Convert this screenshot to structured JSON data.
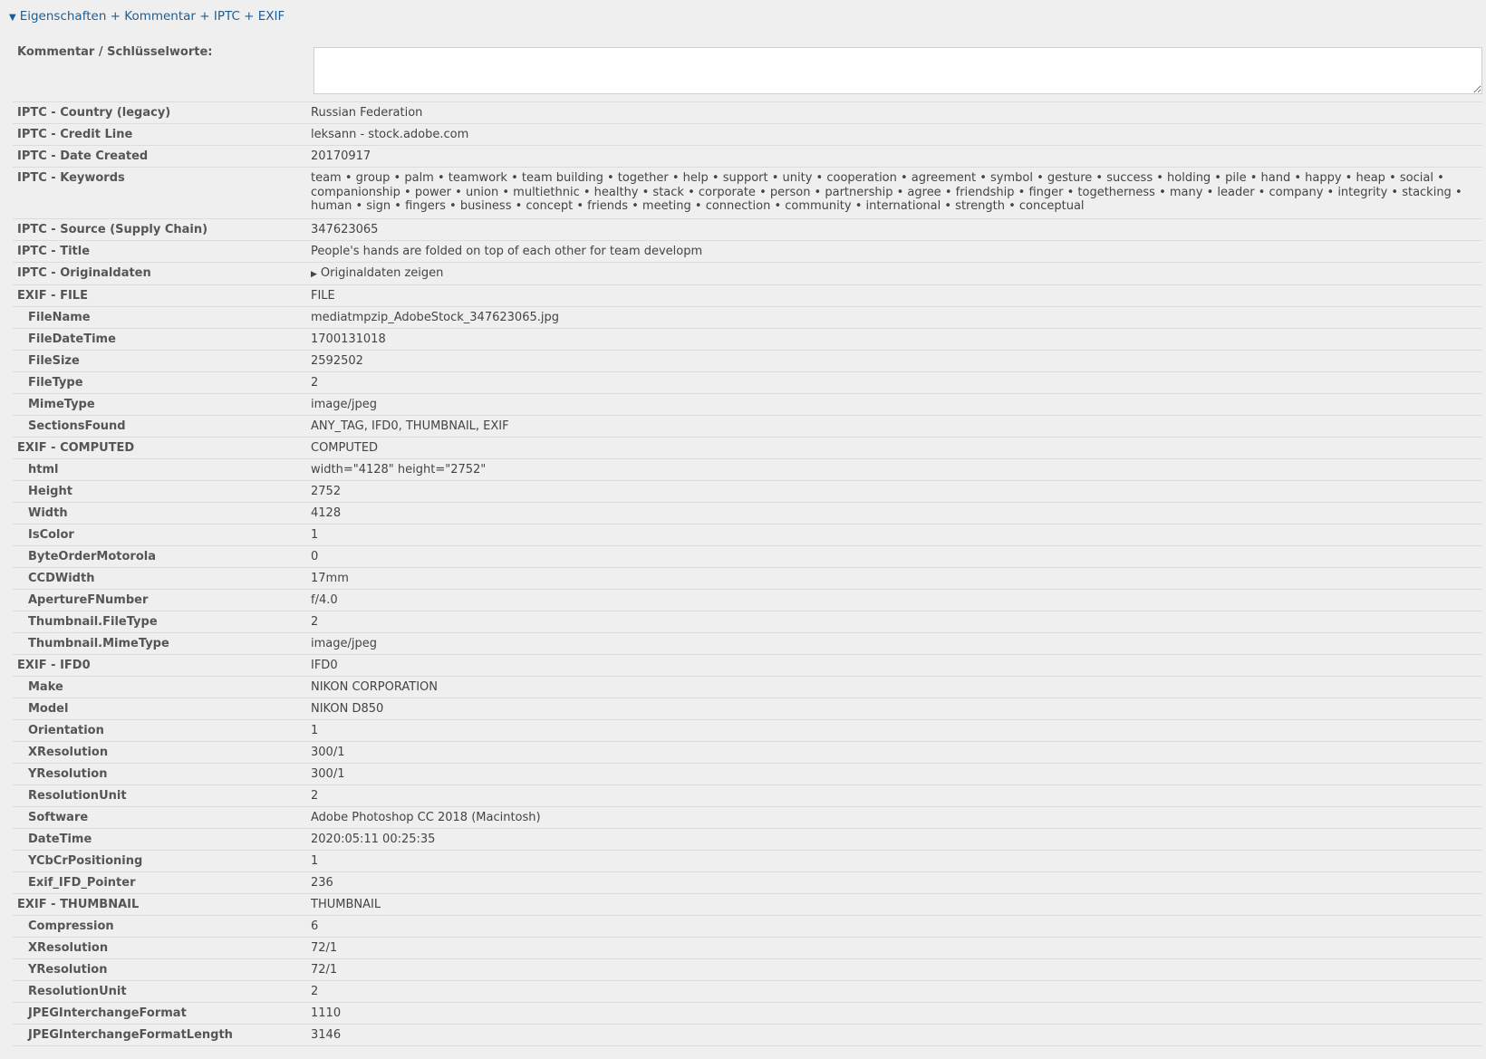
{
  "header": {
    "caret": "▼",
    "title": "Eigenschaften + Kommentar + IPTC + EXIF"
  },
  "comment": {
    "label": "Kommentar / Schlüsselworte:",
    "value": ""
  },
  "iptc": [
    {
      "key": "IPTC - Country (legacy)",
      "value": "Russian Federation"
    },
    {
      "key": "IPTC - Credit Line",
      "value": "leksann - stock.adobe.com"
    },
    {
      "key": "IPTC - Date Created",
      "value": "20170917"
    },
    {
      "key": "IPTC - Keywords",
      "value": "team • group • palm • teamwork • team building • together • help • support • unity • cooperation • agreement • symbol • gesture • success • holding • pile • hand • happy • heap • social • companionship • power • union • multiethnic • healthy • stack • corporate • person • partnership • agree • friendship • finger • togetherness • many • leader • company • integrity • stacking • human • sign • fingers • business • concept • friends • meeting • connection • community • international • strength • conceptual"
    },
    {
      "key": "IPTC - Source (Supply Chain)",
      "value": "347623065"
    },
    {
      "key": "IPTC - Title",
      "value": "People's hands are folded on top of each other for team developm"
    }
  ],
  "iptc_original": {
    "key": "IPTC - Originaldaten",
    "toggle_icon": "▶",
    "toggle_label": "Originaldaten zeigen"
  },
  "exif_file": {
    "key": "EXIF - FILE",
    "value": "FILE",
    "items": [
      {
        "key": "FileName",
        "value": "mediatmpzip_AdobeStock_347623065.jpg"
      },
      {
        "key": "FileDateTime",
        "value": "1700131018"
      },
      {
        "key": "FileSize",
        "value": "2592502"
      },
      {
        "key": "FileType",
        "value": "2"
      },
      {
        "key": "MimeType",
        "value": "image/jpeg"
      },
      {
        "key": "SectionsFound",
        "value": "ANY_TAG, IFD0, THUMBNAIL, EXIF"
      }
    ]
  },
  "exif_computed": {
    "key": "EXIF - COMPUTED",
    "value": "COMPUTED",
    "items": [
      {
        "key": "html",
        "value": "width=\"4128\" height=\"2752\""
      },
      {
        "key": "Height",
        "value": "2752"
      },
      {
        "key": "Width",
        "value": "4128"
      },
      {
        "key": "IsColor",
        "value": "1"
      },
      {
        "key": "ByteOrderMotorola",
        "value": "0"
      },
      {
        "key": "CCDWidth",
        "value": "17mm"
      },
      {
        "key": "ApertureFNumber",
        "value": "f/4.0"
      },
      {
        "key": "Thumbnail.FileType",
        "value": "2"
      },
      {
        "key": "Thumbnail.MimeType",
        "value": "image/jpeg"
      }
    ]
  },
  "exif_ifd0": {
    "key": "EXIF - IFD0",
    "value": "IFD0",
    "items": [
      {
        "key": "Make",
        "value": "NIKON CORPORATION"
      },
      {
        "key": "Model",
        "value": "NIKON D850"
      },
      {
        "key": "Orientation",
        "value": "1"
      },
      {
        "key": "XResolution",
        "value": "300/1"
      },
      {
        "key": "YResolution",
        "value": "300/1"
      },
      {
        "key": "ResolutionUnit",
        "value": "2"
      },
      {
        "key": "Software",
        "value": "Adobe Photoshop CC 2018 (Macintosh)"
      },
      {
        "key": "DateTime",
        "value": "2020:05:11 00:25:35"
      },
      {
        "key": "YCbCrPositioning",
        "value": "1"
      },
      {
        "key": "Exif_IFD_Pointer",
        "value": "236"
      }
    ]
  },
  "exif_thumbnail": {
    "key": "EXIF - THUMBNAIL",
    "value": "THUMBNAIL",
    "items": [
      {
        "key": "Compression",
        "value": "6"
      },
      {
        "key": "XResolution",
        "value": "72/1"
      },
      {
        "key": "YResolution",
        "value": "72/1"
      },
      {
        "key": "ResolutionUnit",
        "value": "2"
      },
      {
        "key": "JPEGInterchangeFormat",
        "value": "1110"
      },
      {
        "key": "JPEGInterchangeFormatLength",
        "value": "3146"
      }
    ]
  }
}
